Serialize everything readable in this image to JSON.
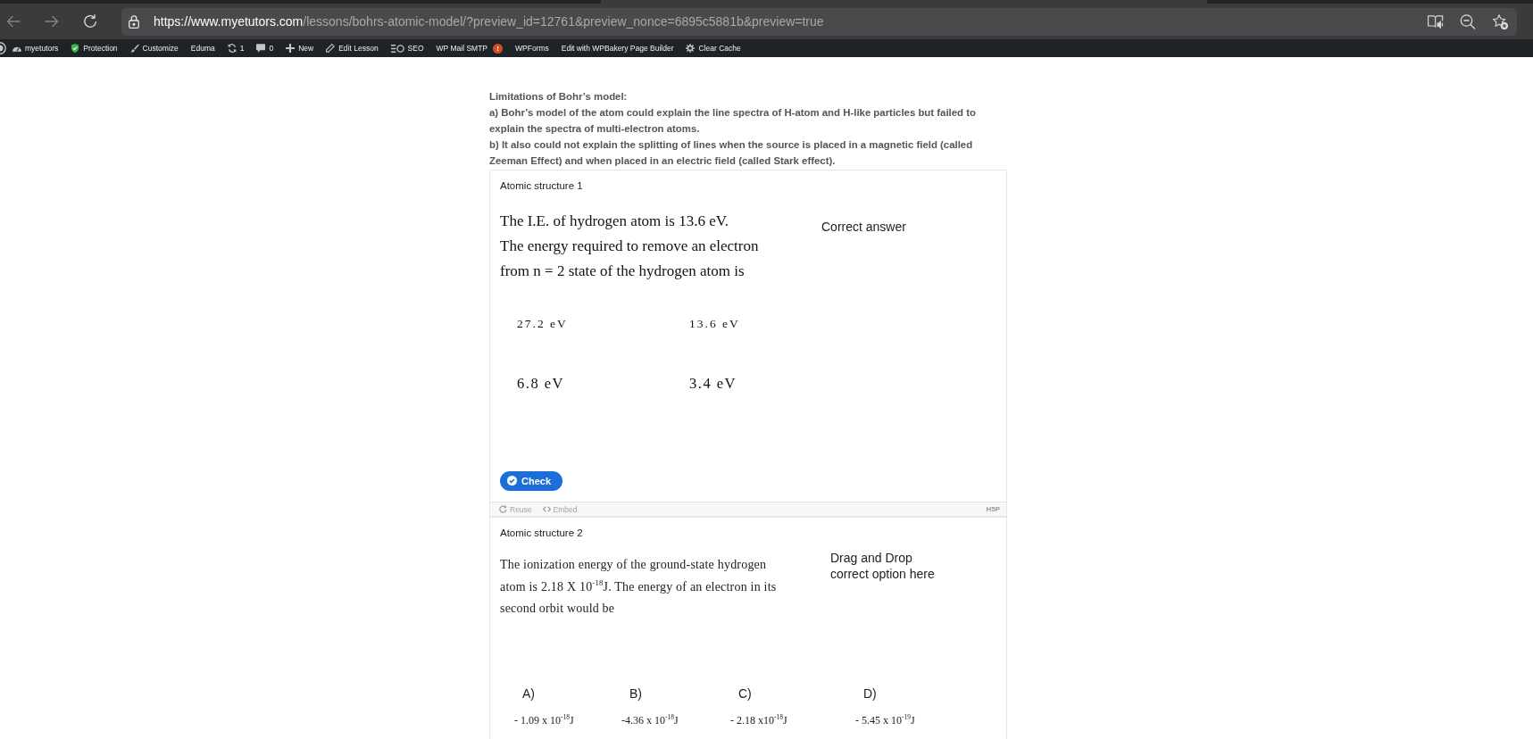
{
  "browser": {
    "nav_buttons": [
      {
        "kind": "back",
        "disabled": true
      },
      {
        "kind": "forward",
        "disabled": true
      },
      {
        "kind": "refresh",
        "disabled": false
      }
    ],
    "address_bar": {
      "url_host": "https://www.myetutors.com",
      "url_path": "/lessons/bohrs-atomic-model/?preview_id=12761&preview_nonce=6895c5881b&preview=true"
    }
  },
  "admin_bar": {
    "items": [
      {
        "kind": "dashboard",
        "label": "myetutors"
      },
      {
        "kind": "protection",
        "label": "Protection"
      },
      {
        "kind": "customize",
        "label": "Customize"
      },
      {
        "kind": "theme",
        "label": "Eduma"
      },
      {
        "kind": "updates",
        "label": "1"
      },
      {
        "kind": "comments",
        "label": "0"
      },
      {
        "kind": "new",
        "label": "New"
      },
      {
        "kind": "edit",
        "label": "Edit Lesson"
      },
      {
        "kind": "seo",
        "label": "SEO"
      },
      {
        "kind": "smtp",
        "label": "WP Mail SMTP",
        "badge": "!"
      },
      {
        "kind": "forms",
        "label": "WPForms"
      },
      {
        "kind": "builder",
        "label": "Edit with WPBakery Page Builder"
      },
      {
        "kind": "cache",
        "label": "Clear Cache"
      }
    ]
  },
  "lesson": {
    "heading": "Limitations of Bohr’s model:",
    "points": [
      "a) Bohr’s model of the atom could explain the line spectra of H-atom and H-like particles but failed to explain the spectra of multi-electron atoms.",
      "b) It also could not explain the splitting of lines when the source is placed in a magnetic field (called Zeeman Effect) and when placed in an electric field (called Stark effect)."
    ]
  },
  "activities": [
    {
      "kind": "grid",
      "title": "Atomic structure 1",
      "question_lines": [
        "The I.E. of hydrogen atom is 13.6 eV.",
        "The energy required to remove an electron",
        "from n = 2 state of the hydrogen atom is"
      ],
      "drop_zone": "Correct answer",
      "options": [
        {
          "text": "27.2 eV"
        },
        {
          "text": "13.6 eV"
        },
        {
          "text": "6.8 eV"
        },
        {
          "text": "3.4 eV"
        }
      ],
      "check_button": "Check",
      "footer": {
        "reuse": "Reuse",
        "embed": "Embed",
        "logo": "H5P"
      }
    },
    {
      "kind": "row",
      "title": "Atomic structure 2",
      "question_lines": [
        "The ionization energy of the ground-state hydrogen",
        "atom is 2.18 X 10$^{-18}$J. The energy of an electron in its",
        "second orbit would be"
      ],
      "drop_zone": "Drag and Drop correct option here",
      "options": [
        {
          "label": "A)",
          "text": "- 1.09 x 10$^{-18}$J"
        },
        {
          "label": "B)",
          "text": "-4.36 x 10$^{-18}$J"
        },
        {
          "label": "C)",
          "text": "- 2.18 x10$^{-18}$J"
        },
        {
          "label": "D)",
          "text": "- 5.45 x 10$^{-19}$J"
        }
      ]
    }
  ]
}
